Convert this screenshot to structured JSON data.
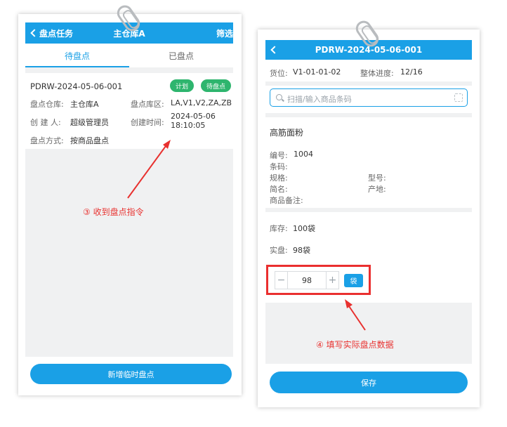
{
  "left_screen": {
    "header": {
      "back_label": "盘点任务",
      "title": "主仓库A",
      "filter_label": "筛选"
    },
    "tabs": [
      {
        "label": "待盘点",
        "active": true
      },
      {
        "label": "已盘点",
        "active": false
      }
    ],
    "task": {
      "code": "PDRW-2024-05-06-001",
      "badges": [
        "计划",
        "待盘点"
      ],
      "warehouse_label": "盘点仓库:",
      "warehouse_value": "主仓库A",
      "area_label": "盘点库区:",
      "area_value": "LA,V1,V2,ZA,ZB",
      "creator_label": "创 建 人:",
      "creator_value": "超级管理员",
      "created_label": "创建时间:",
      "created_date": "2024-05-06",
      "created_time": "18:10:05",
      "method_label": "盘点方式:",
      "method_value": "按商品盘点"
    },
    "add_button_label": "新增临时盘点"
  },
  "right_screen": {
    "header": {
      "title": "PDRW-2024-05-06-001"
    },
    "location_label": "货位:",
    "location_value": "V1-01-01-02",
    "progress_label": "整体进度:",
    "progress_value": "12/16",
    "search": {
      "placeholder": "扫描/输入商品条码"
    },
    "product": {
      "name": "高筋面粉",
      "number_label": "编号:",
      "number_value": "1004",
      "barcode_label": "条码:",
      "spec_label": "规格:",
      "model_label": "型号:",
      "short_label": "简名:",
      "origin_label": "产地:",
      "remark_label": "商品备注:"
    },
    "stock_label": "库存:",
    "stock_value": "100袋",
    "actual_label": "实盘:",
    "actual_value": "98袋",
    "stepper": {
      "minus": "−",
      "value": "98",
      "plus": "+"
    },
    "unit_label": "袋",
    "save_label": "保存"
  },
  "annotations": {
    "step3": "③ 收到盘点指令",
    "step4": "④ 填写实际盘点数据"
  },
  "colors": {
    "primary": "#1aa0e6",
    "badge": "#2eb56e",
    "annotation": "#e8312f"
  }
}
